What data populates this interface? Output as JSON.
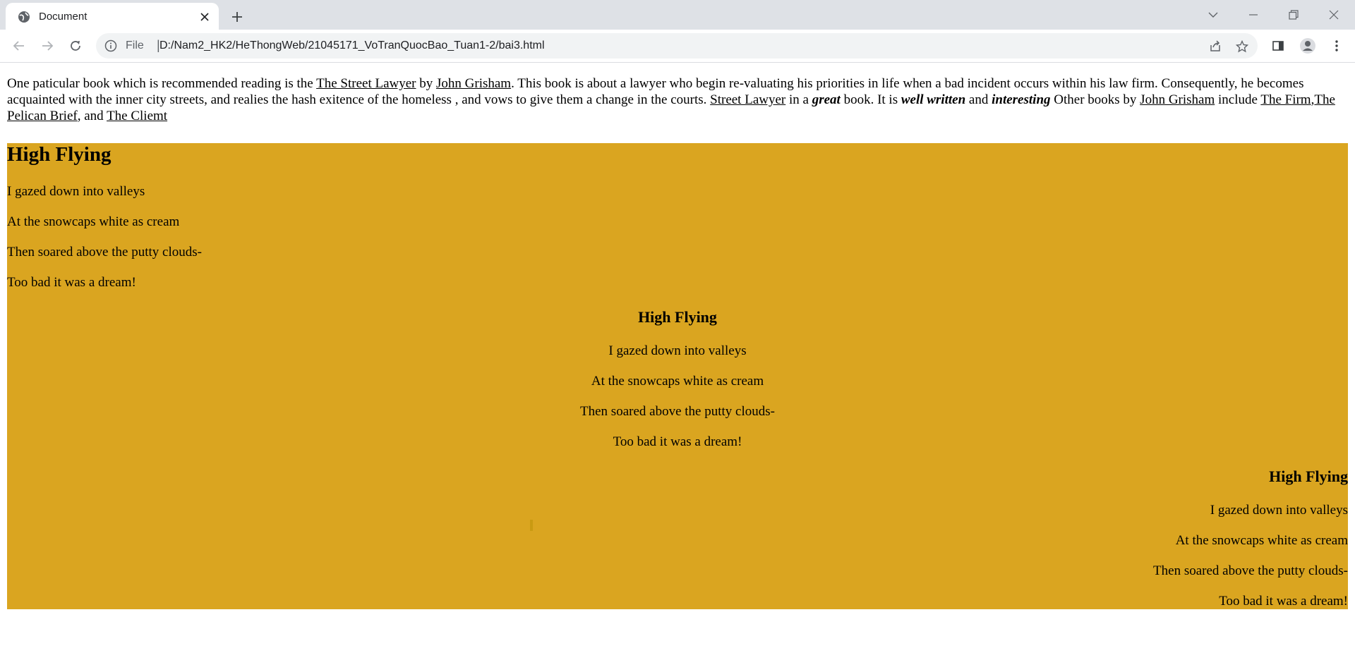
{
  "browser": {
    "tab_title": "Document",
    "address_scheme": "File",
    "address_url": "D:/Nam2_HK2/HeThongWeb/21045171_VoTranQuocBao_Tuan1-2/bai3.html"
  },
  "intro": {
    "t1": "One paticular book which is recommended reading is the ",
    "link1": "The Street Lawyer",
    "t2": " by ",
    "link2": "John Grisham",
    "t3": ". This book is about a lawyer who begin re-valuating his priorities in life when a bad incident occurs within his law firm. Consequently, he becomes acquainted with the inner city streets, and realies the hash exitence of the homeless , and vows to give them a change in the courts. ",
    "link3": "Street Lawyer",
    "t4": " in a ",
    "great": "great",
    "t5": " book. It is ",
    "well_written": "well written",
    "t6": " and ",
    "interesting": "interesting",
    "t7": " Other books by ",
    "link4": "John Grisham",
    "t8": " include ",
    "link5": "The Firm",
    "t9": ",",
    "link6": "The Pelican Brief",
    "t10": ", and ",
    "link7": "The Cliemt"
  },
  "poem": {
    "title": "High Flying",
    "lines": [
      "I gazed down into valleys",
      "At the snowcaps white as cream",
      "Then soared above the putty clouds-",
      "Too bad it was a dream!"
    ]
  },
  "colors": {
    "poem_background": "#daa520"
  }
}
